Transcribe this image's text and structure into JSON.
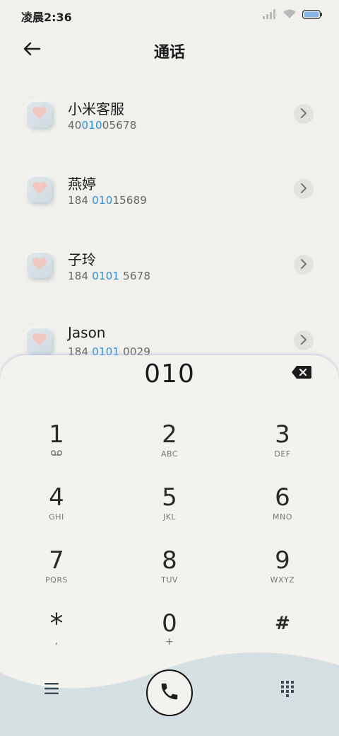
{
  "status_bar": {
    "time": "凌晨2:36",
    "icons": [
      "signal-icon",
      "wifi-icon",
      "battery-icon"
    ]
  },
  "header": {
    "title": "通话",
    "back_icon": "arrow-left-icon"
  },
  "contacts": [
    {
      "name": "小米客服",
      "number_parts": [
        "40",
        "010",
        "05678"
      ],
      "highlight_index": 1
    },
    {
      "name": "燕婷",
      "number_parts": [
        "184 ",
        "010",
        "15689"
      ],
      "highlight_index": 1
    },
    {
      "name": "子玲",
      "number_parts": [
        "184 ",
        "0101",
        " 5678"
      ],
      "highlight_index": 1
    },
    {
      "name": "Jason",
      "number_parts": [
        "184 ",
        "0101",
        " 0029"
      ],
      "highlight_index": 1
    }
  ],
  "dialer": {
    "input": "010",
    "keys": [
      {
        "digit": "1",
        "letters": ""
      },
      {
        "digit": "2",
        "letters": "ABC"
      },
      {
        "digit": "3",
        "letters": "DEF"
      },
      {
        "digit": "4",
        "letters": "GHI"
      },
      {
        "digit": "5",
        "letters": "JKL"
      },
      {
        "digit": "6",
        "letters": "MNO"
      },
      {
        "digit": "7",
        "letters": "PQRS"
      },
      {
        "digit": "8",
        "letters": "TUV"
      },
      {
        "digit": "9",
        "letters": "WXYZ"
      },
      {
        "digit": "*",
        "letters": ","
      },
      {
        "digit": "0",
        "letters": "+"
      },
      {
        "digit": "#",
        "letters": ""
      }
    ]
  },
  "colors": {
    "background": "#f1f0ec",
    "highlight": "#2a8fd6",
    "avatar_heart": "#f2c7c2",
    "wave": "#d6dfe2"
  }
}
